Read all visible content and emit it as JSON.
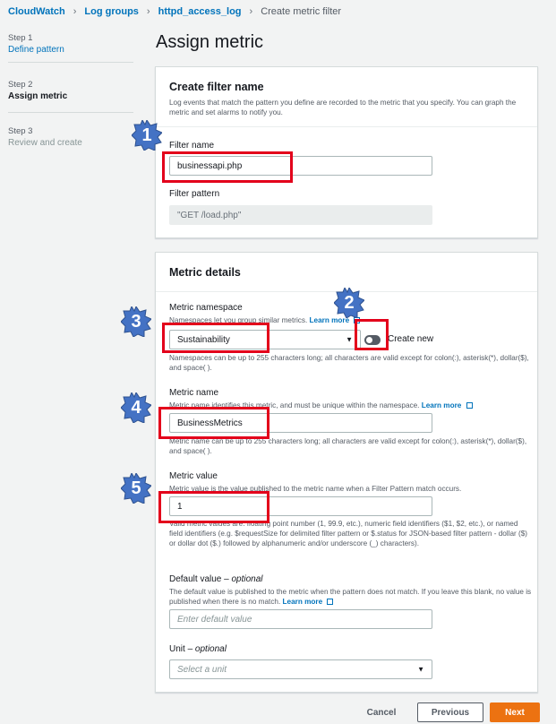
{
  "breadcrumb": {
    "items": [
      "CloudWatch",
      "Log groups",
      "httpd_access_log"
    ],
    "current": "Create metric filter"
  },
  "steps": [
    {
      "num": "Step 1",
      "label": "Define pattern"
    },
    {
      "num": "Step 2",
      "label": "Assign metric"
    },
    {
      "num": "Step 3",
      "label": "Review and create"
    }
  ],
  "page_title": "Assign metric",
  "filter_panel": {
    "heading": "Create filter name",
    "description": "Log events that match the pattern you define are recorded to the metric that you specify. You can graph the metric and set alarms to notify you.",
    "filter_name_label": "Filter name",
    "filter_name_value": "businessapi.php",
    "filter_pattern_label": "Filter pattern",
    "filter_pattern_value": "\"GET /load.php\""
  },
  "metric_panel": {
    "heading": "Metric details",
    "namespace_label": "Metric namespace",
    "namespace_desc": "Namespaces let you group similar metrics.",
    "namespace_learn": "Learn more",
    "namespace_value": "Sustainability",
    "create_new_label": "Create new",
    "namespace_hint": "Namespaces can be up to 255 characters long; all characters are valid except for colon(:), asterisk(*), dollar($), and space( ).",
    "name_label": "Metric name",
    "name_desc": "Metric name identifies this metric, and must be unique within the namespace.",
    "name_learn": "Learn more",
    "name_value": "BusinessMetrics",
    "name_hint": "Metric name can be up to 255 characters long; all characters are valid except for colon(:), asterisk(*), dollar($), and space( ).",
    "value_label": "Metric value",
    "value_desc": "Metric value is the value published to the metric name when a Filter Pattern match occurs.",
    "value_value": "1",
    "value_hint": "Valid metric values are: floating point number (1, 99.9, etc.), numeric field identifiers ($1, $2, etc.), or named field identifiers (e.g. $requestSize for delimited filter pattern or $.status for JSON-based filter pattern - dollar ($) or dollar dot ($.) followed by alphanumeric and/or underscore (_) characters).",
    "default_label": "Default value",
    "default_optional": "optional",
    "default_desc": "The default value is published to the metric when the pattern does not match. If you leave this blank, no value is published when there is no match.",
    "default_learn": "Learn more",
    "default_placeholder": "Enter default value",
    "unit_label": "Unit",
    "unit_optional": "optional",
    "unit_placeholder": "Select a unit"
  },
  "footer": {
    "cancel": "Cancel",
    "previous": "Previous",
    "next": "Next"
  },
  "annotations": [
    "1",
    "2",
    "3",
    "4",
    "5"
  ],
  "colors": {
    "accent": "#0073bb",
    "primary_button": "#ec7211",
    "highlight": "#e3001b",
    "badge": "#4472c4"
  }
}
